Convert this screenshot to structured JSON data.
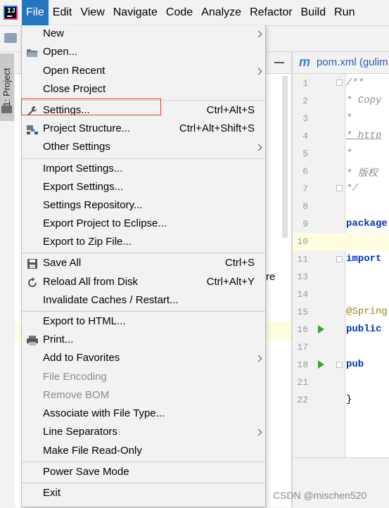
{
  "menubar": {
    "items": [
      {
        "label": "File"
      },
      {
        "label": "Edit"
      },
      {
        "label": "View"
      },
      {
        "label": "Navigate"
      },
      {
        "label": "Code"
      },
      {
        "label": "Analyze"
      },
      {
        "label": "Refactor"
      },
      {
        "label": "Build"
      },
      {
        "label": "Run"
      }
    ]
  },
  "side_panel": {
    "project_tab": "1: Project",
    "peek_text": "re"
  },
  "editor": {
    "tab_label": "pom.xml (gulim",
    "line_numbers": [
      "1",
      "2",
      "3",
      "4",
      "5",
      "6",
      "7",
      "8",
      "9",
      "10",
      "11",
      "13",
      "14",
      "15",
      "16",
      "17",
      "18",
      "21",
      "22"
    ],
    "lines": [
      {
        "num": "1",
        "text": "/**",
        "style": "comment"
      },
      {
        "num": "2",
        "text": " * Copy",
        "style": "comment"
      },
      {
        "num": "3",
        "text": " *",
        "style": "comment"
      },
      {
        "num": "4",
        "text": " * http",
        "style": "comment"
      },
      {
        "num": "5",
        "text": " *",
        "style": "comment"
      },
      {
        "num": "6",
        "text": " * 版权",
        "style": "comment"
      },
      {
        "num": "7",
        "text": " */",
        "style": "comment"
      },
      {
        "num": "9",
        "text": "package",
        "style": "keyword"
      },
      {
        "num": "11",
        "text": "import",
        "style": "keyword"
      },
      {
        "num": "15",
        "text": "@Spring",
        "style": "annotation"
      },
      {
        "num": "16",
        "text": "public",
        "style": "keyword"
      },
      {
        "num": "18",
        "text": "   pub",
        "style": "keyword"
      },
      {
        "num": "22",
        "text": "}",
        "style": "plain"
      }
    ]
  },
  "file_menu": {
    "items": {
      "new": {
        "label": "New",
        "submenu": true
      },
      "open": {
        "label": "Open...",
        "icon": "folder-open-icon"
      },
      "open_recent": {
        "label": "Open Recent",
        "submenu": true
      },
      "close_project": {
        "label": "Close Project"
      },
      "settings": {
        "label": "Settings...",
        "shortcut": "Ctrl+Alt+S",
        "icon": "wrench-icon"
      },
      "project_structure": {
        "label": "Project Structure...",
        "shortcut": "Ctrl+Alt+Shift+S",
        "icon": "project-structure-icon"
      },
      "other_settings": {
        "label": "Other Settings",
        "submenu": true
      },
      "import_settings": {
        "label": "Import Settings..."
      },
      "export_settings": {
        "label": "Export Settings..."
      },
      "settings_repository": {
        "label": "Settings Repository..."
      },
      "export_eclipse": {
        "label": "Export Project to Eclipse..."
      },
      "export_zip": {
        "label": "Export to Zip File..."
      },
      "save_all": {
        "label": "Save All",
        "shortcut": "Ctrl+S",
        "icon": "save-icon"
      },
      "reload": {
        "label": "Reload All from Disk",
        "shortcut": "Ctrl+Alt+Y",
        "icon": "reload-icon"
      },
      "invalidate": {
        "label": "Invalidate Caches / Restart..."
      },
      "export_html": {
        "label": "Export to HTML..."
      },
      "print": {
        "label": "Print...",
        "icon": "printer-icon"
      },
      "favorites": {
        "label": "Add to Favorites",
        "submenu": true
      },
      "file_encoding": {
        "label": "File Encoding",
        "disabled": true
      },
      "remove_bom": {
        "label": "Remove BOM",
        "disabled": true
      },
      "associate": {
        "label": "Associate with File Type..."
      },
      "line_separators": {
        "label": "Line Separators",
        "submenu": true
      },
      "read_only": {
        "label": "Make File Read-Only"
      },
      "power_save": {
        "label": "Power Save Mode"
      },
      "exit": {
        "label": "Exit"
      }
    }
  },
  "watermark": "CSDN @mischen520",
  "colors": {
    "menu_active": "#2675bf",
    "highlight_box": "#e03c3c",
    "line_highlight": "#fffde0",
    "run_arrow": "#3aa23c"
  }
}
